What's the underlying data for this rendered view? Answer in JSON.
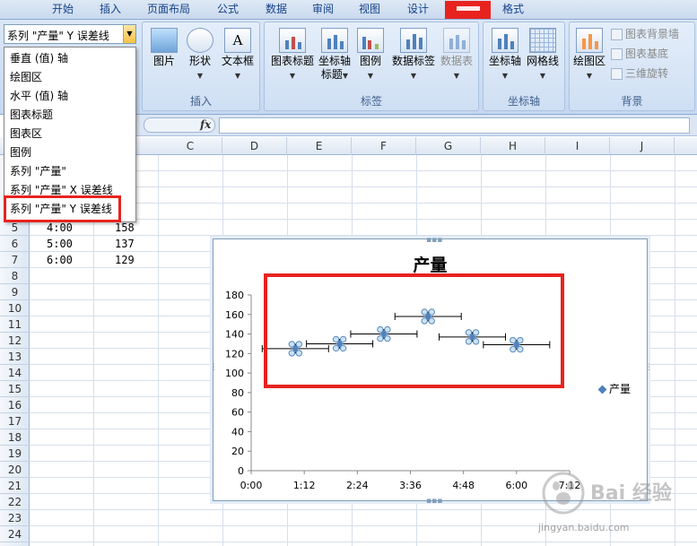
{
  "tabs": [
    "开始",
    "插入",
    "页面布局",
    "公式",
    "数据",
    "审阅",
    "视图",
    "设计",
    "布局",
    "格式"
  ],
  "selector": {
    "value": "系列 \"产量\" Y 误差线"
  },
  "dropdown_items": [
    "垂直 (值) 轴",
    "绘图区",
    "水平 (值) 轴",
    "图表标题",
    "图表区",
    "图例",
    "系列 \"产量\"",
    "系列 \"产量\" X 误差线",
    "系列 \"产量\" Y 误差线"
  ],
  "ribbon": {
    "insert": {
      "label": "插入",
      "buttons": [
        "图片",
        "形状",
        "文本框"
      ]
    },
    "labels": {
      "label": "标签",
      "buttons": [
        "图表标题",
        "坐标轴\n标题",
        "图例",
        "数据标签",
        "数据表"
      ]
    },
    "axes": {
      "label": "坐标轴",
      "buttons": [
        "坐标轴",
        "网格线"
      ]
    },
    "background": {
      "label": "背景",
      "big": "绘图区",
      "small": [
        "图表背景墙",
        "图表基底",
        "三维旋转"
      ]
    }
  },
  "formula": {
    "fx": "fx",
    "content": ""
  },
  "columns": [
    "C",
    "D",
    "E",
    "F",
    "G",
    "H",
    "I",
    "J"
  ],
  "rows": [
    "5",
    "6",
    "7",
    "8",
    "9",
    "10",
    "11",
    "12",
    "13",
    "14",
    "15",
    "16",
    "17",
    "18",
    "19",
    "20",
    "21",
    "22",
    "23",
    "24"
  ],
  "cells": [
    {
      "a": "4:00",
      "b": "158"
    },
    {
      "a": "5:00",
      "b": "137"
    },
    {
      "a": "6:00",
      "b": "129"
    }
  ],
  "chart_data": {
    "type": "scatter",
    "title": "产量",
    "series": [
      {
        "name": "产量",
        "x": [
          "1:00",
          "2:00",
          "3:00",
          "4:00",
          "5:00",
          "6:00"
        ],
        "y": [
          125,
          130,
          140,
          158,
          137,
          129
        ]
      }
    ],
    "x_ticks": [
      "0:00",
      "1:12",
      "2:24",
      "3:36",
      "4:48",
      "6:00",
      "7:12"
    ],
    "y_ticks": [
      0,
      20,
      40,
      60,
      80,
      100,
      120,
      140,
      160,
      180
    ],
    "ylim": [
      0,
      180
    ],
    "x_error_bars": true,
    "y_error_bars": true,
    "legend_position": "right",
    "marker_color": "#4f81bd"
  },
  "watermark": {
    "text": "Bai 经验",
    "url": "jingyan.baidu.com"
  }
}
